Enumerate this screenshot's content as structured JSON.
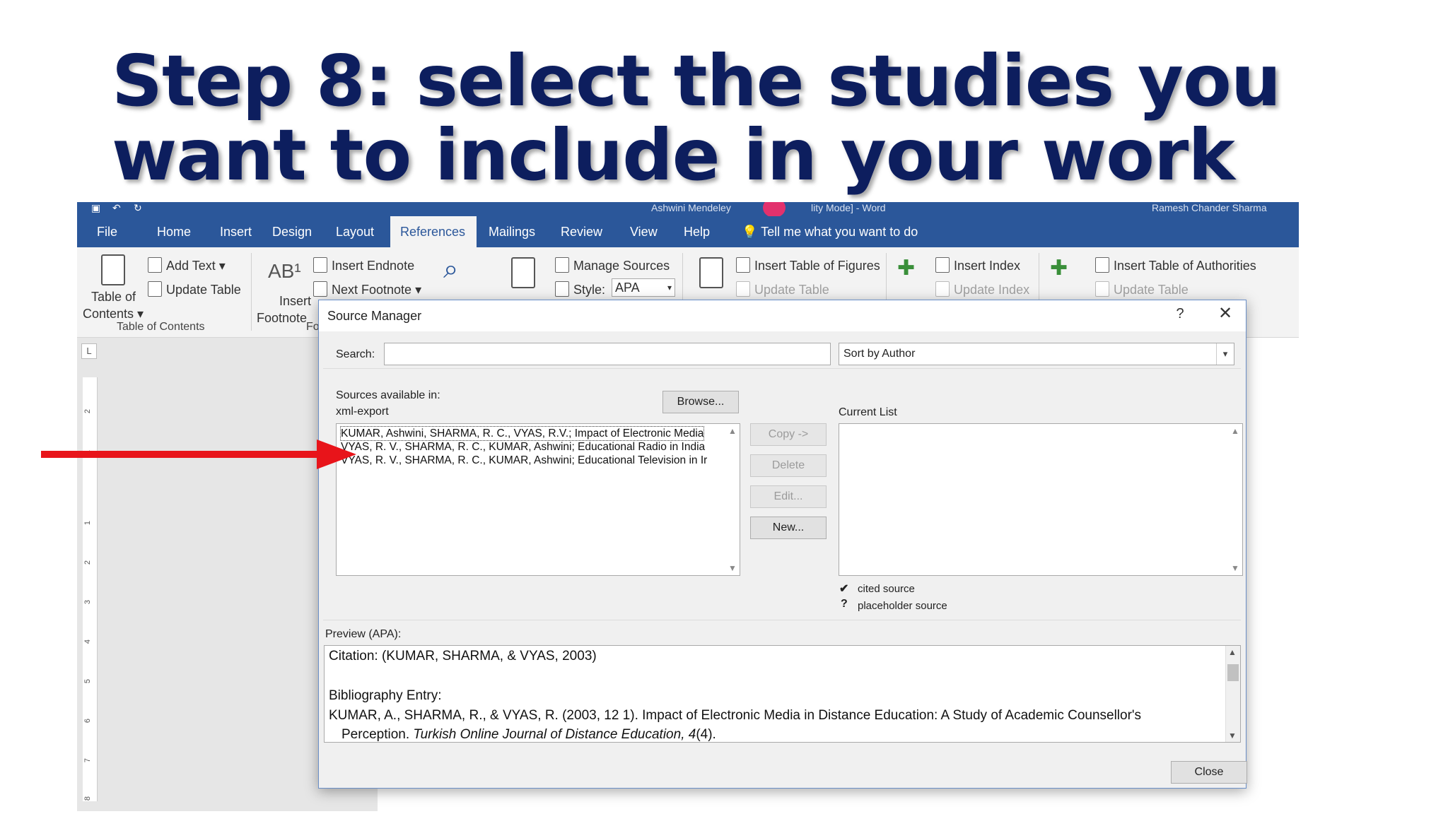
{
  "slide": {
    "title": "Step 8: select the studies you want to include in your work"
  },
  "word": {
    "titlebar": {
      "left_text": "Ashwini Mendeley",
      "doc_text": "lity Mode] - Word",
      "user": "Ramesh Chander Sharma"
    },
    "tabs": [
      {
        "label": "File"
      },
      {
        "label": "Home"
      },
      {
        "label": "Insert"
      },
      {
        "label": "Design"
      },
      {
        "label": "Layout"
      },
      {
        "label": "References"
      },
      {
        "label": "Mailings"
      },
      {
        "label": "Review"
      },
      {
        "label": "View"
      },
      {
        "label": "Help"
      }
    ],
    "tell_me": "Tell me what you want to do",
    "ribbon": {
      "toc_line1": "Table of",
      "toc_line2": "Contents",
      "add_text": "Add Text",
      "update_table": "Update Table",
      "toc_group": "Table of Contents",
      "insert_footnote_line1": "Insert",
      "insert_footnote_line2": "Footnote",
      "insert_endnote": "Insert Endnote",
      "next_footnote": "Next Footnote",
      "footnotes_group_partial": "Fo",
      "manage_sources": "Manage Sources",
      "style_label": "Style:",
      "style_value": "APA",
      "insert_table_of_figures": "Insert Table of Figures",
      "update_table_captions": "Update Table",
      "insert_index": "Insert Index",
      "update_index": "Update Index",
      "insert_table_of_authorities": "Insert Table of Authorities",
      "update_table_authorities": "Update Table"
    },
    "ruler_numbers": [
      "2",
      "1",
      "1",
      "2",
      "3",
      "4",
      "5",
      "6",
      "7",
      "8"
    ]
  },
  "dialog": {
    "title": "Source Manager",
    "help": "?",
    "search_label": "Search:",
    "search_value": "",
    "sort_value": "Sort by Author",
    "sources_label": "Sources available in:",
    "sources_location": "xml-export",
    "browse": "Browse...",
    "current_list_label": "Current List",
    "sources": [
      "KUMAR, Ashwini, SHARMA, R. C., VYAS, R.V.; Impact of Electronic Media",
      "VYAS, R. V., SHARMA, R. C., KUMAR, Ashwini; Educational Radio in India",
      "VYAS, R. V., SHARMA, R. C., KUMAR, Ashwini; Educational Television in Ir"
    ],
    "buttons": {
      "copy": "Copy ->",
      "delete": "Delete",
      "edit": "Edit...",
      "new": "New...",
      "close": "Close"
    },
    "legend": {
      "cited_symbol": "✔",
      "cited": "cited source",
      "placeholder_symbol": "?",
      "placeholder": "placeholder source"
    },
    "preview_label": "Preview (APA):",
    "preview": {
      "citation": "Citation:  (KUMAR, SHARMA, & VYAS, 2003)",
      "bib_label": "Bibliography Entry:",
      "bib_line1": "KUMAR, A., SHARMA, R., & VYAS, R. (2003, 12 1). Impact of Electronic Media in Distance Education: A Study of Academic Counsellor's",
      "bib_line2_plain": "Perception. ",
      "bib_journal": "Turkish Online Journal of Distance Education, 4",
      "bib_issue": "(4)."
    }
  },
  "colors": {
    "title": "#0d1e5e",
    "ribbon_blue": "#2b579a",
    "arrow": "#e8141a"
  }
}
